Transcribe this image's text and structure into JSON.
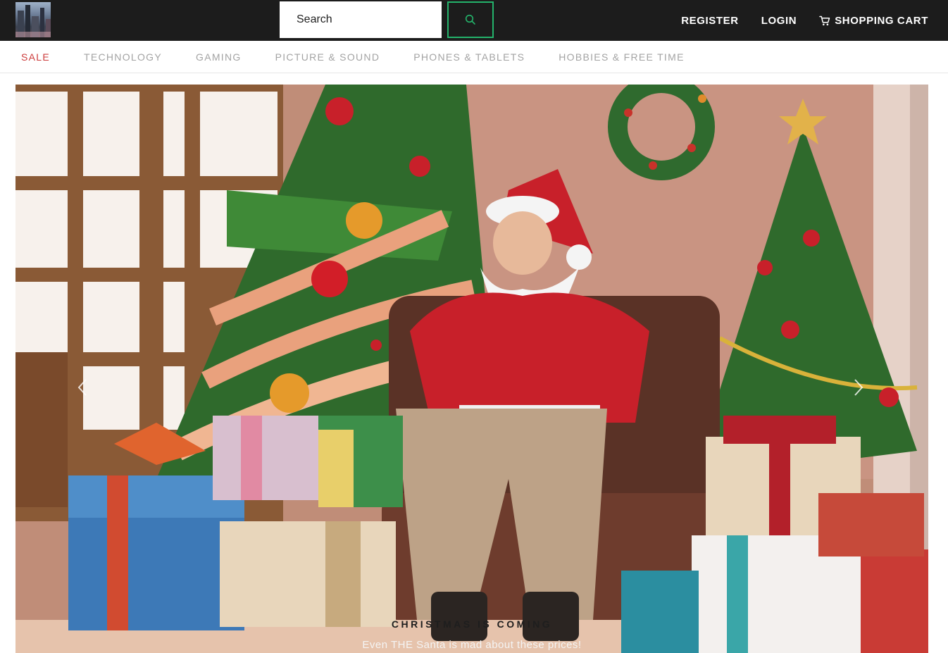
{
  "header": {
    "logo_icon": "city-skyline-logo",
    "search": {
      "placeholder": "Search",
      "value": "",
      "button_icon": "search-icon"
    },
    "nav": [
      {
        "label": "REGISTER"
      },
      {
        "label": "LOGIN"
      },
      {
        "label": "SHOPPING CART",
        "icon": "shopping-cart-icon"
      }
    ]
  },
  "categories": [
    {
      "label": "SALE",
      "active": true
    },
    {
      "label": "TECHNOLOGY",
      "active": false
    },
    {
      "label": "GAMING",
      "active": false
    },
    {
      "label": "PICTURE & SOUND",
      "active": false
    },
    {
      "label": "PHONES & TABLETS",
      "active": false
    },
    {
      "label": "HOBBIES & FREE TIME",
      "active": false
    }
  ],
  "hero": {
    "image_icon": "santa-christmas-illustration",
    "caption_title": "CHRISTMAS IS COMING",
    "caption_subtitle": "Even THE Santa is mad about these prices!",
    "prev_icon": "chevron-left-icon",
    "next_icon": "chevron-right-icon"
  },
  "colors": {
    "topbar_bg": "#1c1c1c",
    "accent_green": "#24b36b",
    "sale_red": "#cc3b3b",
    "category_gray": "#a3a3a3"
  }
}
